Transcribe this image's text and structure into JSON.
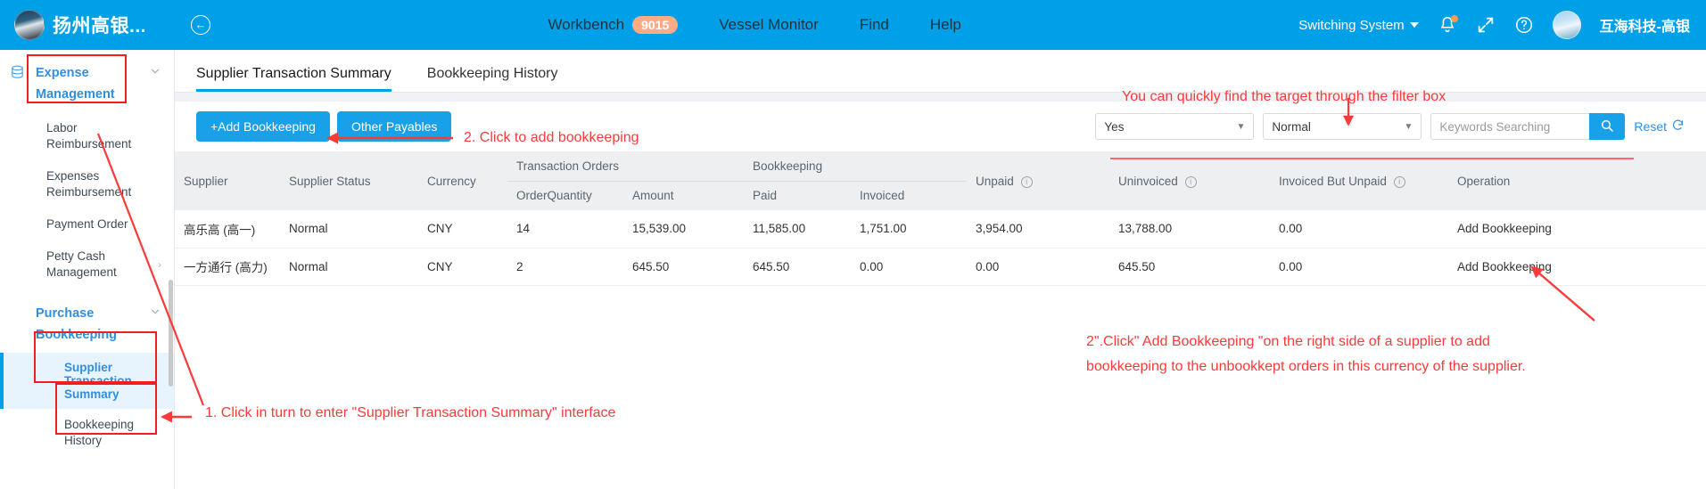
{
  "header": {
    "brand_title": "扬州高银...",
    "collapse_icon": "collapse-left-icon",
    "nav": [
      {
        "label": "Workbench",
        "badge": "9015"
      },
      {
        "label": "Vessel Monitor",
        "badge": ""
      },
      {
        "label": "Find",
        "badge": ""
      },
      {
        "label": "Help",
        "badge": ""
      }
    ],
    "switch_system": "Switching System",
    "icons": [
      "bell-icon",
      "fullscreen-icon",
      "help-circle-icon"
    ],
    "user_name": "互海科技-高银"
  },
  "sidebar": {
    "groups": [
      {
        "label": "Expense Management",
        "icon": "database-icon",
        "chevron": "chevron-down-icon",
        "items": [
          {
            "label": "Labor Reimbursement",
            "active": false,
            "arrow": false
          },
          {
            "label": "Expenses Reimbursement",
            "active": false,
            "arrow": false
          },
          {
            "label": "Payment Order",
            "active": false,
            "arrow": false
          },
          {
            "label": "Petty Cash Management",
            "active": false,
            "arrow": true
          }
        ]
      },
      {
        "label": "Purchase Bookkeeping",
        "icon": "",
        "chevron": "chevron-down-icon",
        "items": [
          {
            "label": "Supplier Transaction Summary",
            "active": true,
            "arrow": false
          },
          {
            "label": "Bookkeeping History",
            "active": false,
            "arrow": false
          }
        ]
      }
    ]
  },
  "main": {
    "tabs": [
      {
        "label": "Supplier Transaction Summary",
        "active": true
      },
      {
        "label": "Bookkeeping History",
        "active": false
      }
    ],
    "toolbar": {
      "add_bookkeeping_label": "+Add Bookkeeping",
      "other_payables_label": "Other Payables"
    },
    "filters": {
      "select1_value": "Yes",
      "select2_value": "Normal",
      "search_placeholder": "Keywords Searching",
      "search_value": "",
      "search_icon": "search-icon",
      "reset_label": "Reset",
      "reset_icon": "refresh-icon"
    },
    "table": {
      "group_headers": [
        {
          "label": "Transaction Orders"
        },
        {
          "label": "Bookkeeping"
        }
      ],
      "columns": [
        {
          "key": "supplier",
          "label": "Supplier",
          "info": false
        },
        {
          "key": "supplier_status",
          "label": "Supplier Status",
          "info": false
        },
        {
          "key": "currency",
          "label": "Currency",
          "info": false
        },
        {
          "key": "order_quantity",
          "label": "OrderQuantity",
          "info": false
        },
        {
          "key": "amount",
          "label": "Amount",
          "info": false
        },
        {
          "key": "paid",
          "label": "Paid",
          "info": false
        },
        {
          "key": "invoiced",
          "label": "Invoiced",
          "info": false
        },
        {
          "key": "unpaid",
          "label": "Unpaid",
          "info": true
        },
        {
          "key": "uninvoiced",
          "label": "Uninvoiced",
          "info": true
        },
        {
          "key": "invoiced_but_unpaid",
          "label": "Invoiced But Unpaid",
          "info": true
        },
        {
          "key": "operation",
          "label": "Operation",
          "info": false
        }
      ],
      "rows": [
        {
          "supplier": "高乐高 (高一)",
          "supplier_status": "Normal",
          "currency": "CNY",
          "order_quantity": "14",
          "amount": "15,539.00",
          "paid": "11,585.00",
          "invoiced": "1,751.00",
          "unpaid": "3,954.00",
          "uninvoiced": "13,788.00",
          "invoiced_but_unpaid": "0.00",
          "operation": "Add Bookkeeping"
        },
        {
          "supplier": "一方通行 (高力)",
          "supplier_status": "Normal",
          "currency": "CNY",
          "order_quantity": "2",
          "amount": "645.50",
          "paid": "645.50",
          "invoiced": "0.00",
          "unpaid": "0.00",
          "uninvoiced": "645.50",
          "invoiced_but_unpaid": "0.00",
          "operation": "Add Bookkeeping"
        }
      ]
    }
  },
  "annotations": {
    "filter_hint": "You can quickly find the target through the filter box",
    "step2_toolbar": "2. Click to add bookkeeping",
    "step1_sidebar": "1. Click in turn to enter \"Supplier Transaction Summary\" interface",
    "step2_row_line1": "2\".Click\" Add Bookkeeping \"on the right side of a supplier to add",
    "step2_row_line2": "bookkeeping to the unbookkept orders in this currency of the supplier.",
    "color": "#fb3a3a"
  }
}
